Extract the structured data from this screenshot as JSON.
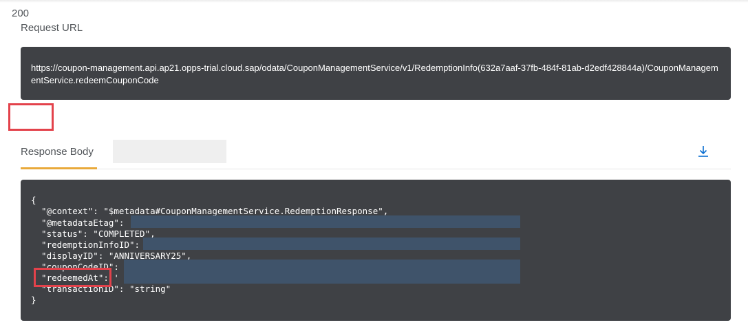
{
  "request": {
    "label": "Request URL",
    "url": "https://coupon-management.api.ap21.opps-trial.cloud.sap/odata/CouponManagementService/v1/RedemptionInfo(632a7aaf-37fb-484f-81ab-d2edf428844a)/CouponManagementService.redeemCouponCode"
  },
  "response": {
    "status_code": "200",
    "tab_label": "Response Body",
    "download_icon": "download-icon",
    "body_lines": [
      "{",
      "  \"@context\": \"$metadata#CouponManagementService.RedemptionResponse\",",
      "  \"@metadataEtag\": ",
      "  \"status\": \"COMPLETED\",",
      "  \"redemptionInfoID\": ",
      "  \"displayID\": \"ANNIVERSARY25\",",
      "  \"couponCodeID\": ",
      "  \"redeemedAt\": '",
      "  \"transactionID\": \"string\"",
      "}"
    ]
  },
  "colors": {
    "code_background": "#3f4145",
    "highlight_border": "#e3424b",
    "active_tab_underline": "#e9a93a",
    "link_icon": "#0a6ed1",
    "redaction": "#3f536a"
  }
}
